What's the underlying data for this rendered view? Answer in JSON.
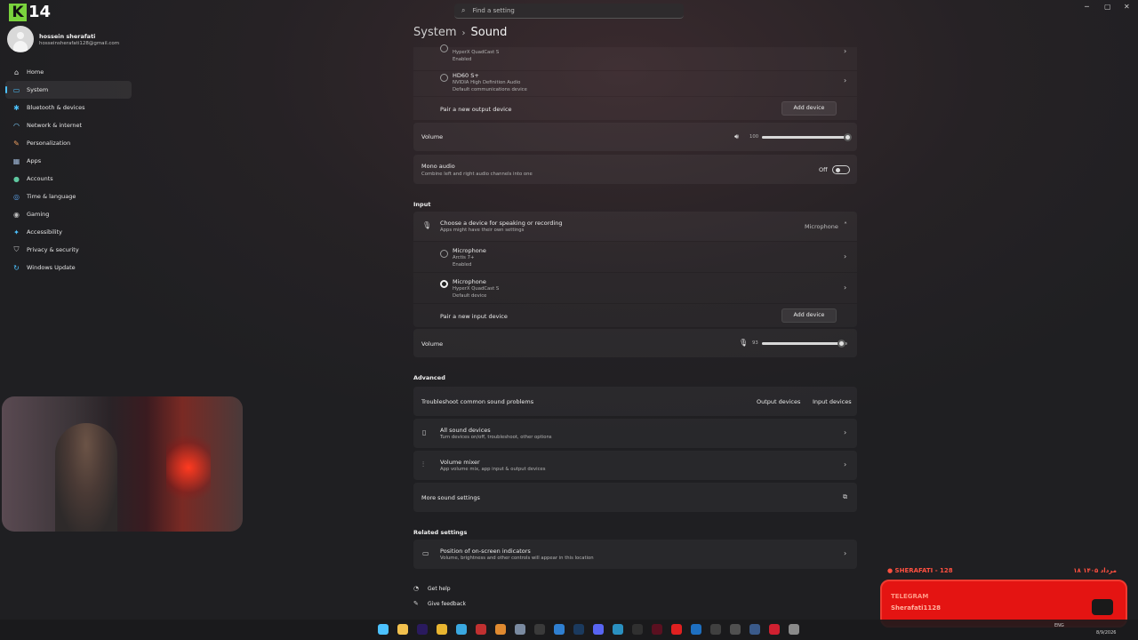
{
  "window": {
    "title_partial": "Settings",
    "search_placeholder": "Find a setting",
    "controls": {
      "minimize": "─",
      "maximize": "▢",
      "close": "✕"
    }
  },
  "overlay_logo": {
    "k": "K",
    "num": "14"
  },
  "user": {
    "name": "hossein sherafati",
    "email": "hosseinsherafati128@gmail.com"
  },
  "nav": [
    {
      "label": "Home",
      "icon": "home-icon",
      "glyph": "⌂",
      "color": "#e0e0e0"
    },
    {
      "label": "System",
      "icon": "monitor-icon",
      "glyph": "▭",
      "color": "#4cc2ff",
      "active": true
    },
    {
      "label": "Bluetooth & devices",
      "icon": "bluetooth-icon",
      "glyph": "✱",
      "color": "#4cc2ff"
    },
    {
      "label": "Network & internet",
      "icon": "wifi-icon",
      "glyph": "◠",
      "color": "#7fd0ff"
    },
    {
      "label": "Personalization",
      "icon": "brush-icon",
      "glyph": "✎",
      "color": "#f0a060"
    },
    {
      "label": "Apps",
      "icon": "apps-icon",
      "glyph": "▦",
      "color": "#9fb8d8"
    },
    {
      "label": "Accounts",
      "icon": "person-icon",
      "glyph": "●",
      "color": "#5fc8a0"
    },
    {
      "label": "Time & language",
      "icon": "globe-icon",
      "glyph": "◎",
      "color": "#5aa0e8"
    },
    {
      "label": "Gaming",
      "icon": "gamepad-icon",
      "glyph": "◉",
      "color": "#bdbdbd"
    },
    {
      "label": "Accessibility",
      "icon": "accessibility-icon",
      "glyph": "✦",
      "color": "#4cc2ff"
    },
    {
      "label": "Privacy & security",
      "icon": "shield-icon",
      "glyph": "⛉",
      "color": "#bdbdbd"
    },
    {
      "label": "Windows Update",
      "icon": "update-icon",
      "glyph": "↻",
      "color": "#4cc2ff"
    }
  ],
  "breadcrumb": {
    "parent": "System",
    "separator": "›",
    "current": "Sound"
  },
  "output": {
    "device_top": {
      "sub1": "HyperX QuadCast S",
      "sub2": "Enabled"
    },
    "device_hd60": {
      "name": "HD60 S+",
      "sub1": "NVIDIA High Definition Audio",
      "sub2": "Default communications device"
    },
    "pair_label": "Pair a new output device",
    "add_button": "Add device",
    "volume_label": "Volume",
    "volume_value": "100",
    "volume_level": 100,
    "mono_title": "Mono audio",
    "mono_sub": "Combine left and right audio channels into one",
    "mono_state": "Off"
  },
  "input": {
    "section": "Input",
    "choose_title": "Choose a device for speaking or recording",
    "choose_sub": "Apps might have their own settings",
    "selected": "Microphone",
    "devices": [
      {
        "name": "Microphone",
        "sub1": "Arctis 7+",
        "sub2": "Enabled",
        "selected": false
      },
      {
        "name": "Microphone",
        "sub1": "HyperX QuadCast S",
        "sub2": "Default device",
        "selected": true
      }
    ],
    "pair_label": "Pair a new input device",
    "add_button": "Add device",
    "volume_label": "Volume",
    "volume_value": "93",
    "volume_level": 93
  },
  "advanced": {
    "section": "Advanced",
    "troubleshoot": "Troubleshoot common sound problems",
    "output_devices": "Output devices",
    "input_devices": "Input devices",
    "all_title": "All sound devices",
    "all_sub": "Turn devices on/off, troubleshoot, other options",
    "mixer_title": "Volume mixer",
    "mixer_sub": "App volume mix, app input & output devices",
    "more": "More sound settings"
  },
  "related": {
    "section": "Related settings",
    "pos_title": "Position of on-screen indicators",
    "pos_sub": "Volume, brightness and other controls will appear in this location"
  },
  "help": {
    "get_help": "Get help",
    "feedback": "Give feedback"
  },
  "telegram": {
    "top_left": "● SHERAFATI - 128",
    "top_right": "۱۸ مرداد ۱۴۰۵",
    "line1": "TELEGRAM",
    "line2": "Sherafati1128"
  },
  "tray": {
    "lang": "ENG",
    "date": "8/9/2026"
  },
  "taskbar_icons": [
    {
      "name": "start-icon",
      "color": "#4cc2ff"
    },
    {
      "name": "file-explorer-icon",
      "color": "#f2c14e"
    },
    {
      "name": "premiere-icon",
      "color": "#2a1a5e"
    },
    {
      "name": "chrome-icon",
      "color": "#e8b530"
    },
    {
      "name": "app-blue-icon",
      "color": "#3aa8e0"
    },
    {
      "name": "app-red-icon",
      "color": "#c03030"
    },
    {
      "name": "app-orange-icon",
      "color": "#e08a30"
    },
    {
      "name": "pen-icon",
      "color": "#7a8aa0"
    },
    {
      "name": "terminal-icon",
      "color": "#3a3a3a"
    },
    {
      "name": "app-circle-icon",
      "color": "#2f7fd0"
    },
    {
      "name": "steam-icon",
      "color": "#1b3a5e"
    },
    {
      "name": "discord-icon",
      "color": "#5865f2"
    },
    {
      "name": "app-square-icon",
      "color": "#2a90c0"
    },
    {
      "name": "app-dark-icon",
      "color": "#303030"
    },
    {
      "name": "app-maroon-icon",
      "color": "#5a1020"
    },
    {
      "name": "youtube-icon",
      "color": "#e02020"
    },
    {
      "name": "vscode-icon",
      "color": "#1e6fc0"
    },
    {
      "name": "app-grid-icon",
      "color": "#404040"
    },
    {
      "name": "clock-icon",
      "color": "#505050"
    },
    {
      "name": "app-w-icon",
      "color": "#3a5a8a"
    },
    {
      "name": "app-red2-icon",
      "color": "#d02030"
    },
    {
      "name": "settings-icon",
      "color": "#8a8a8a"
    }
  ]
}
